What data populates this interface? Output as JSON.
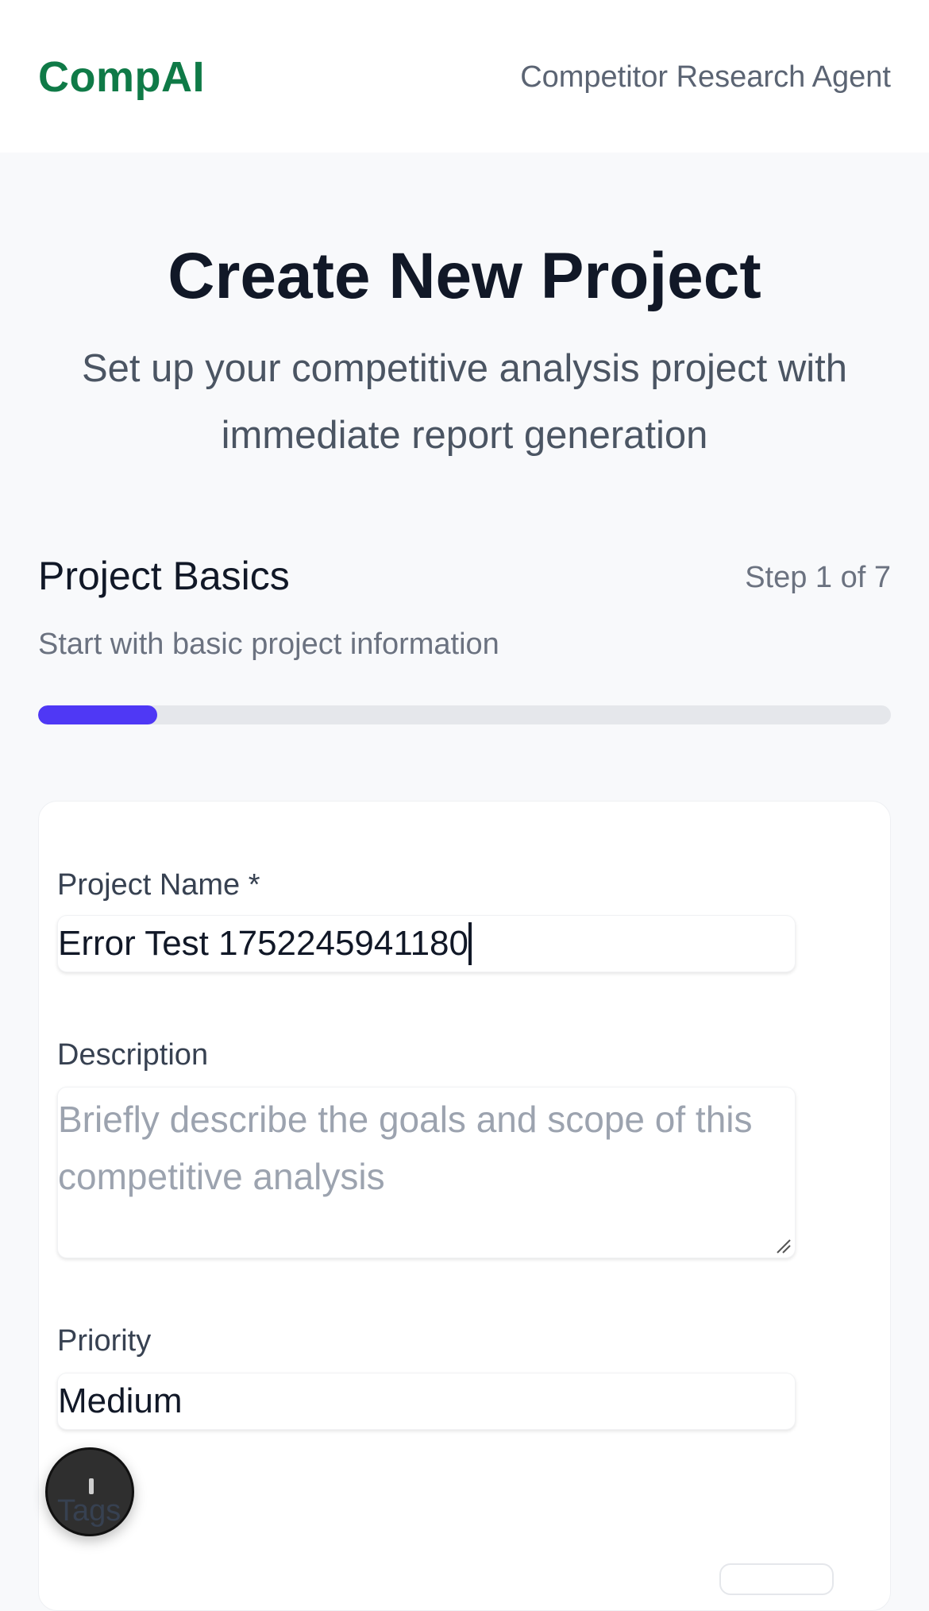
{
  "header": {
    "brand": "CompAI",
    "tagline": "Competitor Research Agent"
  },
  "hero": {
    "title": "Create New Project",
    "subtitle": "Set up your competitive analysis project with immediate report generation"
  },
  "step": {
    "title": "Project Basics",
    "counter": "Step 1 of 7",
    "description": "Start with basic project information",
    "progress_fraction": 0.14
  },
  "form": {
    "project_name": {
      "label": "Project Name *",
      "value": "Error Test 1752245941180"
    },
    "description": {
      "label": "Description",
      "placeholder": "Briefly describe the goals and scope of this competitive analysis"
    },
    "priority": {
      "label": "Priority",
      "value": "Medium"
    },
    "tags": {
      "label": "Tags"
    }
  },
  "colors": {
    "brand": "#0f7a47",
    "progress": "#4f38f5"
  },
  "icons": {
    "fab": "assistant-icon",
    "resize": "resize-grip-icon"
  }
}
